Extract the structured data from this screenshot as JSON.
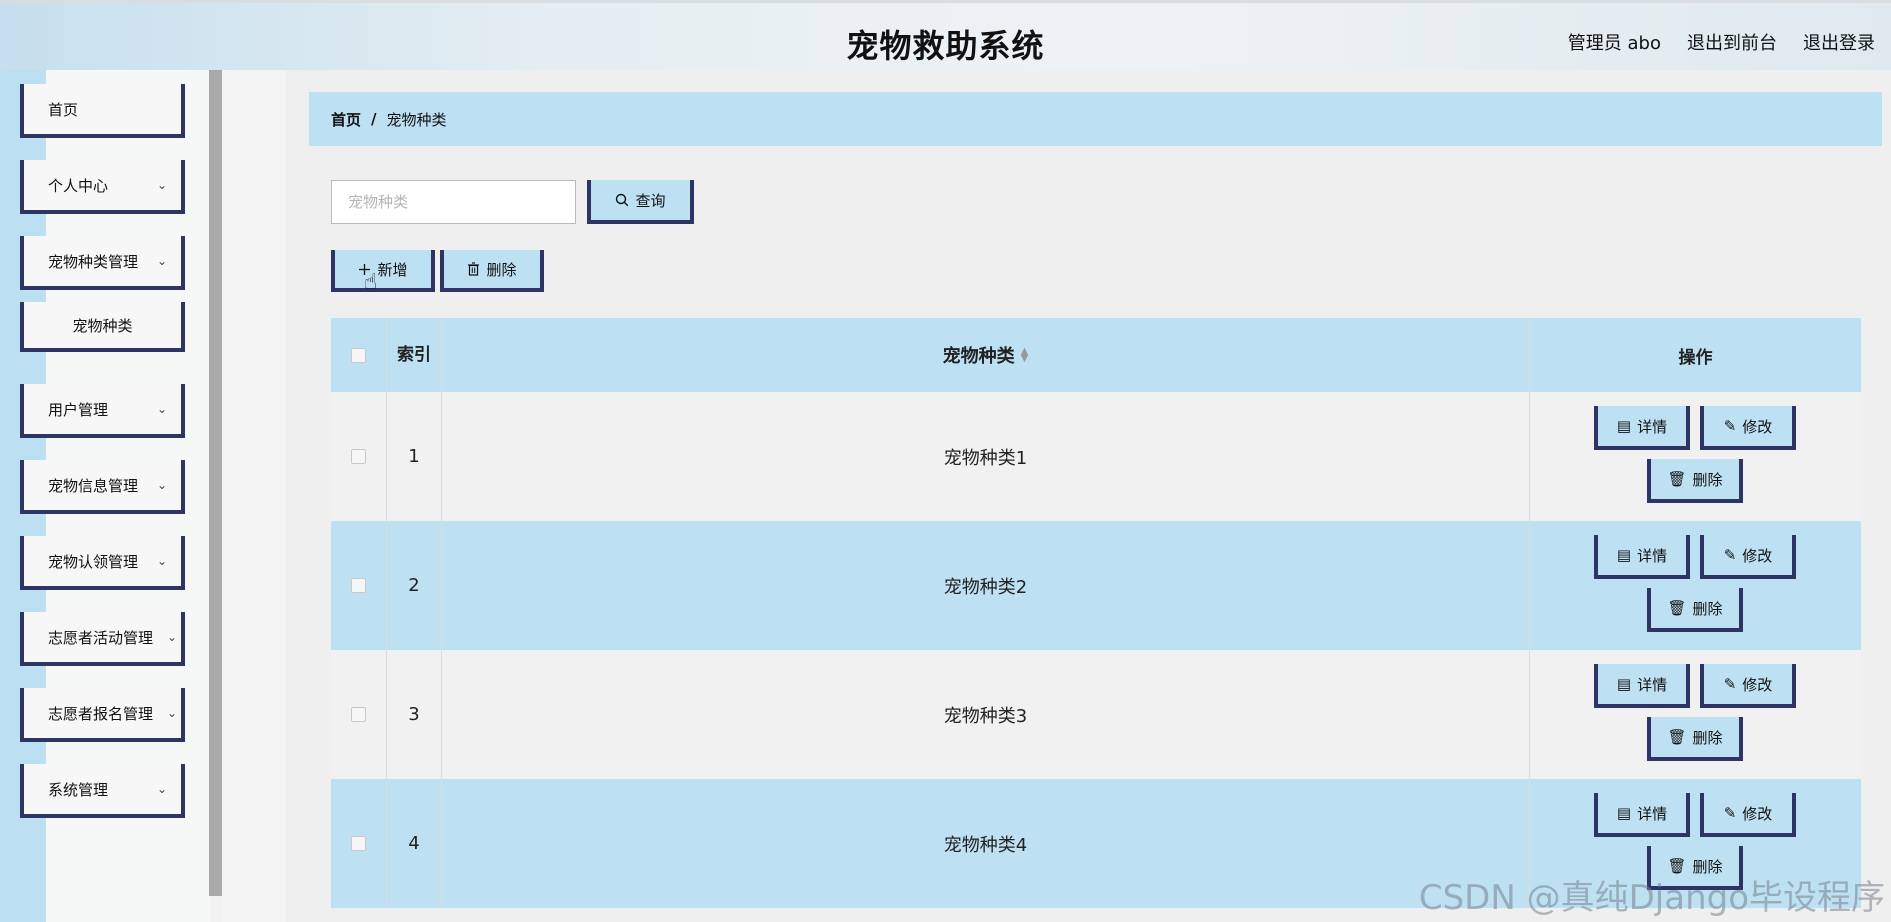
{
  "header": {
    "title": "宠物救助系统",
    "admin_label": "管理员 abo",
    "to_front_label": "退出到前台",
    "logout_label": "退出登录"
  },
  "sidebar": {
    "items": [
      {
        "label": "首页"
      },
      {
        "label": "个人中心"
      },
      {
        "label": "宠物种类管理"
      },
      {
        "label": "宠物种类"
      },
      {
        "label": "用户管理"
      },
      {
        "label": "宠物信息管理"
      },
      {
        "label": "宠物认领管理"
      },
      {
        "label": "志愿者活动管理"
      },
      {
        "label": "志愿者报名管理"
      },
      {
        "label": "系统管理"
      }
    ],
    "chevron": "⌄"
  },
  "breadcrumb": {
    "home": "首页",
    "separator": "/",
    "current": "宠物种类"
  },
  "search": {
    "placeholder": "宠物种类",
    "value": "",
    "button_label": "查询",
    "button_icon": "search-icon"
  },
  "toolbar": {
    "add_label": "新增",
    "add_icon": "plus-icon",
    "delete_label": "删除",
    "delete_icon": "trash-icon"
  },
  "table": {
    "columns": {
      "index": "索引",
      "name": "宠物种类",
      "ops": "操作"
    },
    "rows": [
      {
        "index": "1",
        "name": "宠物种类1"
      },
      {
        "index": "2",
        "name": "宠物种类2"
      },
      {
        "index": "3",
        "name": "宠物种类3"
      },
      {
        "index": "4",
        "name": "宠物种类4"
      }
    ],
    "ops": {
      "detail_label": "详情",
      "edit_label": "修改",
      "delete_label": "删除"
    }
  },
  "watermark": "CSDN @真纯Django毕设程序",
  "colors": {
    "accent": "#bde0f3",
    "border_dark": "#2e3564",
    "sidebar_strip": "#bcdff1"
  }
}
